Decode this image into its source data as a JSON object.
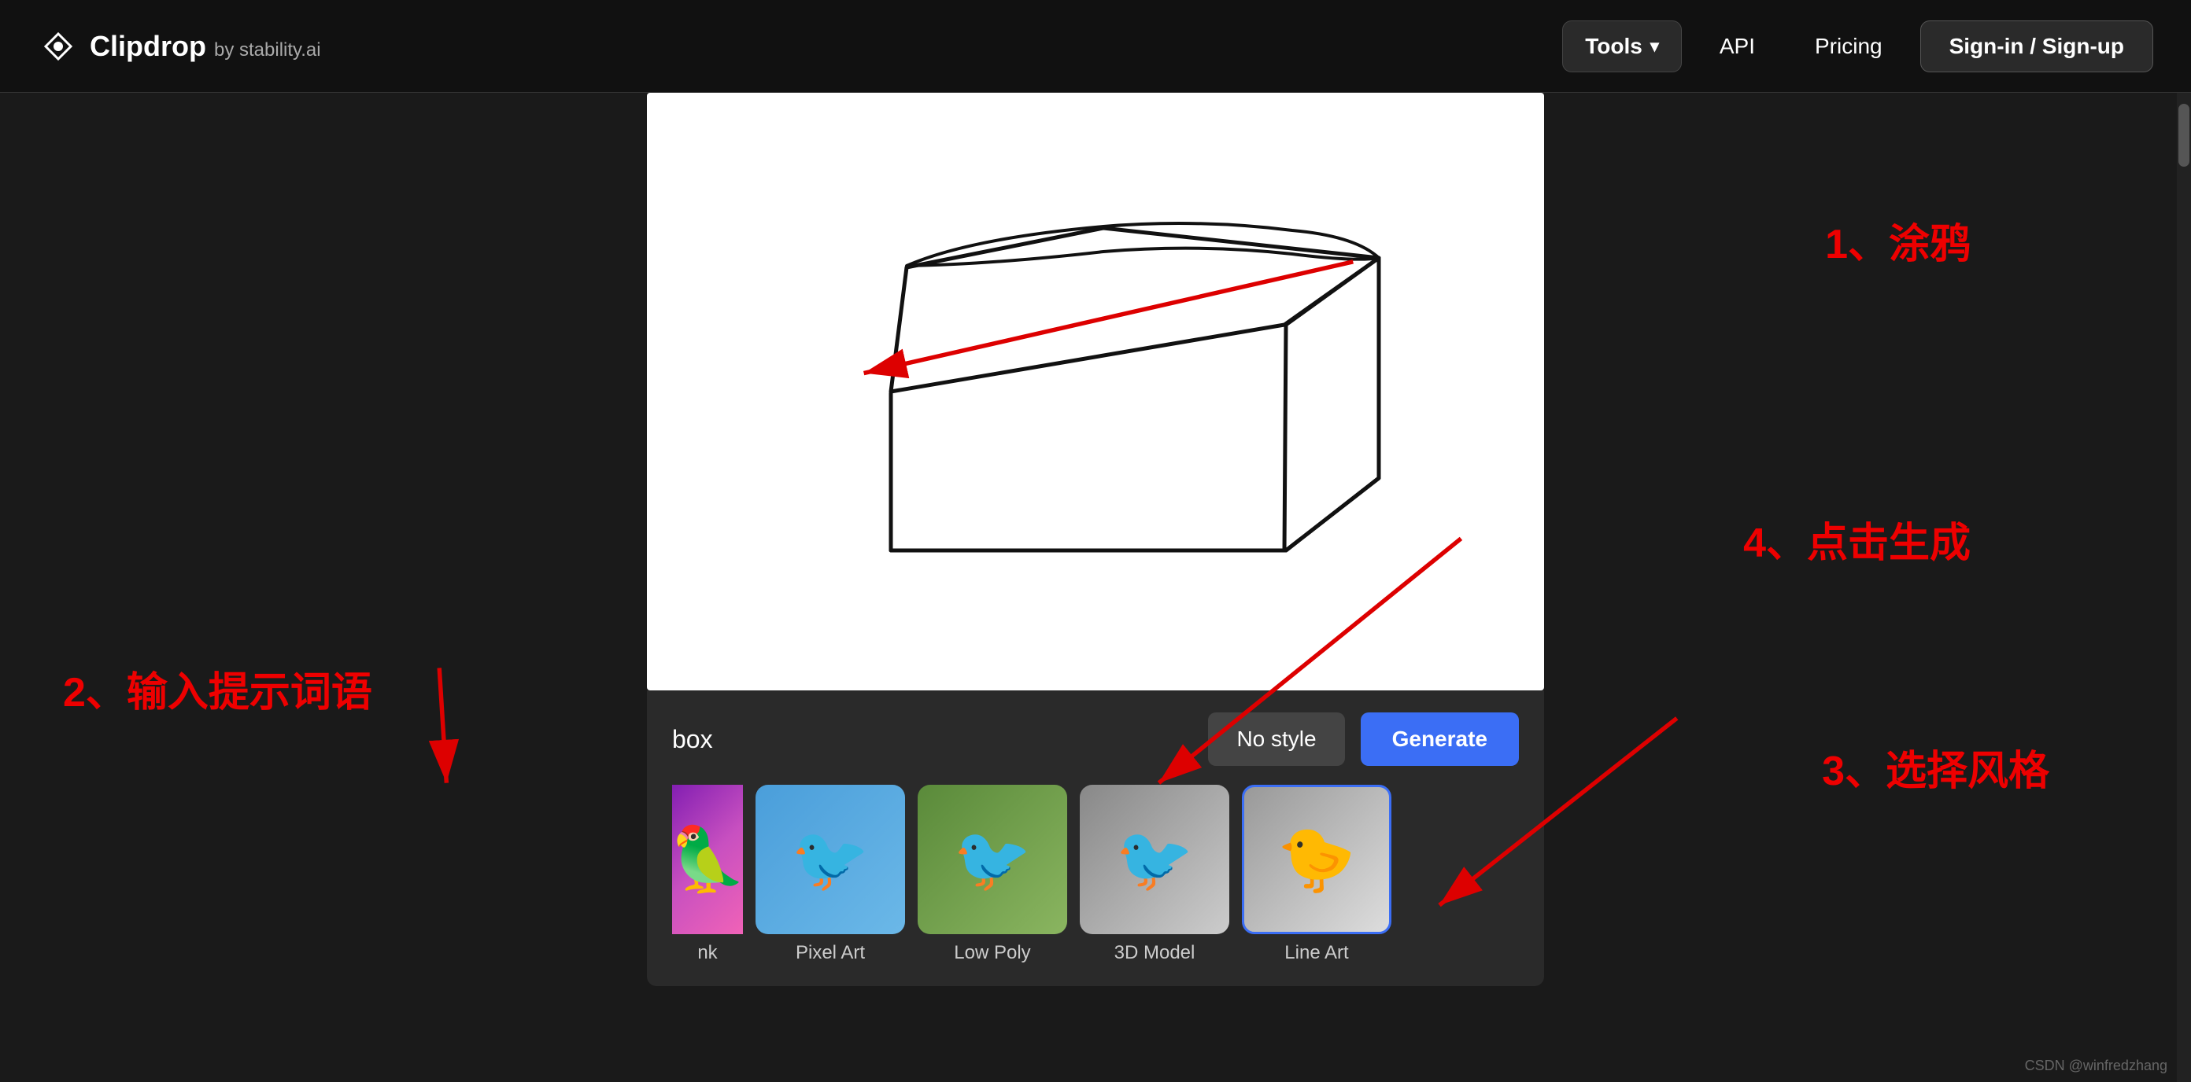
{
  "header": {
    "logo_name": "Clipdrop",
    "logo_by": "by stability.ai",
    "nav": {
      "tools_label": "Tools",
      "api_label": "API",
      "pricing_label": "Pricing",
      "signin_label": "Sign-in / Sign-up"
    }
  },
  "canvas": {
    "prompt_value": "box",
    "prompt_placeholder": "box",
    "no_style_label": "No style",
    "generate_label": "Generate"
  },
  "styles": [
    {
      "id": "ink",
      "label": "nk",
      "selected": false,
      "color_class": "bird-ink"
    },
    {
      "id": "pixel-art",
      "label": "Pixel Art",
      "selected": false,
      "color_class": "bird-pixel"
    },
    {
      "id": "low-poly",
      "label": "Low Poly",
      "selected": false,
      "color_class": "bird-lowpoly"
    },
    {
      "id": "3d-model",
      "label": "3D Model",
      "selected": false,
      "color_class": "bird-3d"
    },
    {
      "id": "line-art",
      "label": "Line Art",
      "selected": true,
      "color_class": "bird-lineart"
    }
  ],
  "annotations": {
    "step1": "1、涂鸦",
    "step2": "2、输入提示词语",
    "step3": "3、选择风格",
    "step4": "4、点击生成"
  },
  "watermark": "CSDN @winfredzhang"
}
